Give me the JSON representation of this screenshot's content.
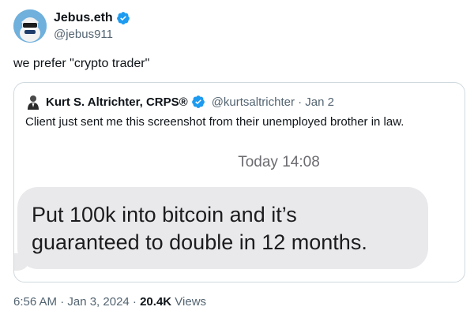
{
  "author": {
    "name": "Jebus.eth",
    "handle": "@jebus911"
  },
  "tweet": {
    "text": "we prefer \"crypto trader\""
  },
  "quoted": {
    "name": "Kurt S. Altrichter, CRPS®",
    "handle_date": "@kurtsaltrichter · Jan 2",
    "text": "Client just sent me this screenshot from their unemployed brother in law.",
    "screenshot": {
      "time": "Today 14:08",
      "message_line1": "Put 100k into bitcoin and it’s",
      "message_line2": "guaranteed to double in 12 months."
    }
  },
  "meta": {
    "timestamp": "6:56 AM · Jan 3, 2024 · ",
    "views_count": "20.4K",
    "views_label": " Views"
  },
  "colors": {
    "verified": "#1d9bf0",
    "secondary_text": "#536471",
    "bubble": "#e9e9eb"
  },
  "icons": {
    "verified": "verified-badge-icon"
  }
}
